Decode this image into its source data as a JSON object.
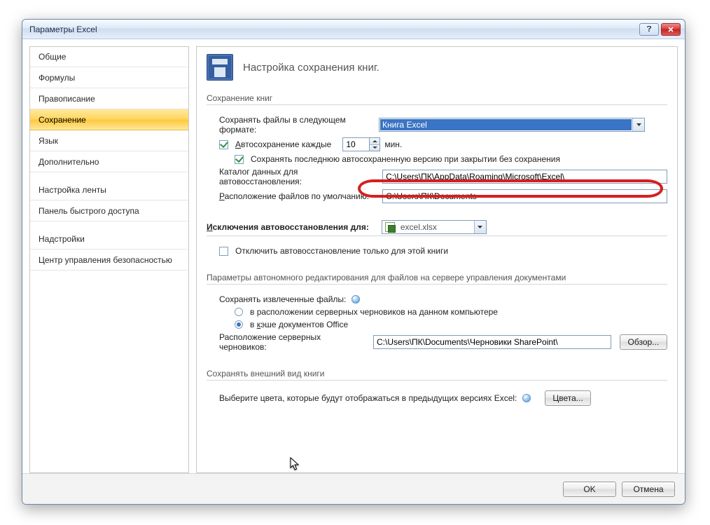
{
  "dialog": {
    "title": "Параметры Excel",
    "sidebar": {
      "items": [
        {
          "label": "Общие"
        },
        {
          "label": "Формулы"
        },
        {
          "label": "Правописание"
        },
        {
          "label": "Сохранение"
        },
        {
          "label": "Язык"
        },
        {
          "label": "Дополнительно"
        },
        {
          "label": "Настройка ленты"
        },
        {
          "label": "Панель быстрого доступа"
        },
        {
          "label": "Надстройки"
        },
        {
          "label": "Центр управления безопасностью"
        }
      ],
      "selected_index": 3
    },
    "header": "Настройка сохранения книг.",
    "section_save": {
      "title": "Сохранение книг",
      "format_label": "Сохранять файлы в следующем формате:",
      "format_value": "Книга Excel",
      "autosave_prefix": "Автосохранение каждые",
      "autosave_A": "А",
      "autosave_value": "10",
      "minutes": "мин.",
      "autosave_enabled": true,
      "keep_last_enabled": true,
      "keep_last_label": "Сохранять последнюю автосохраненную версию при закрытии без сохранения",
      "recover_dir_label": "Каталог данных для автовосстановления:",
      "recover_dir_value": "C:\\Users\\ПК\\AppData\\Roaming\\Microsoft\\Excel\\",
      "default_dir_label": "Расположение файлов по умолчанию:",
      "default_dir_value": "C:\\Users\\ПК\\Documents",
      "recover_dir_R": "Р"
    },
    "section_except": {
      "title_prefix": "Исключения автовосстановления для:",
      "title_I": "И",
      "file_value": "excel.xlsx",
      "disable_label": "Отключить автовосстановление только для этой книги",
      "disable_checked": false
    },
    "section_server": {
      "title": "Параметры автономного редактирования для файлов на сервере управления документами",
      "saveto_label": "Сохранять извлеченные файлы:",
      "opt_drafts": "в расположении серверных черновиков на данном компьютере",
      "opt_cache": "в кэше документов Office",
      "opt_cache_K": "к",
      "drafts_loc_label": "Расположение серверных черновиков:",
      "drafts_loc_value": "C:\\Users\\ПК\\Documents\\Черновики SharePoint\\",
      "browse": "Обзор..."
    },
    "section_appearance": {
      "title": "Сохранять внешний вид книги",
      "colors_hint": "Выберите цвета, которые будут отображаться в предыдущих версиях Excel:",
      "colors_btn": "Цвета..."
    },
    "footer": {
      "ok": "OK",
      "cancel": "Отмена"
    }
  }
}
